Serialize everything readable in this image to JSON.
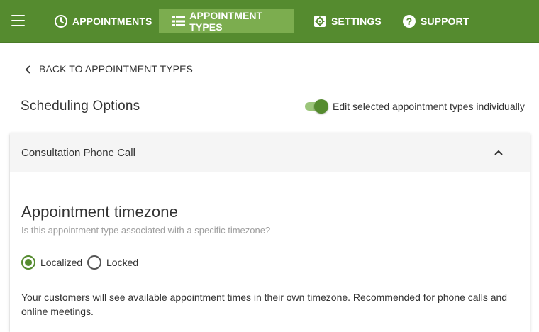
{
  "nav": {
    "items": [
      {
        "label": "APPOINTMENTS",
        "icon": "clock-icon"
      },
      {
        "label": "APPOINTMENT TYPES",
        "icon": "list-icon"
      },
      {
        "label": "SETTINGS",
        "icon": "gear-icon"
      },
      {
        "label": "SUPPORT",
        "icon": "help-icon"
      }
    ],
    "active": "APPOINTMENT TYPES",
    "bar_color": "#558b2f",
    "active_color": "#7cad4f"
  },
  "back_link": {
    "label": "BACK TO APPOINTMENT TYPES"
  },
  "scheduling": {
    "title": "Scheduling Options",
    "toggle_label": "Edit selected appointment types individually",
    "toggle_on": true
  },
  "card": {
    "title": "Consultation Phone Call",
    "expanded": true,
    "timezone": {
      "title": "Appointment timezone",
      "subtitle": "Is this appointment type associated with a specific timezone?",
      "options": [
        {
          "label": "Localized",
          "checked": true
        },
        {
          "label": "Locked",
          "checked": false
        }
      ],
      "description": "Your customers will see available appointment times in their own timezone. Recommended for phone calls and online meetings."
    }
  }
}
